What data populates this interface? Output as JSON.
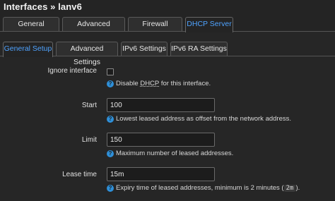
{
  "page": {
    "title": "Interfaces » lanv6"
  },
  "main_tabs": [
    {
      "label": "General Settings"
    },
    {
      "label": "Advanced Settings"
    },
    {
      "label": "Firewall Settings"
    },
    {
      "label": "DHCP Server"
    }
  ],
  "dhcp_tabs": [
    {
      "label": "General Setup"
    },
    {
      "label": "Advanced Settings"
    },
    {
      "label": "IPv6 Settings"
    },
    {
      "label": "IPv6 RA Settings"
    }
  ],
  "form": {
    "ignore_interface": {
      "label": "Ignore interface",
      "checked": false,
      "help_prefix": "Disable ",
      "help_abbr": "DHCP",
      "help_suffix": " for this interface."
    },
    "start": {
      "label": "Start",
      "value": "100",
      "help": "Lowest leased address as offset from the network address."
    },
    "limit": {
      "label": "Limit",
      "value": "150",
      "help": "Maximum number of leased addresses."
    },
    "lease_time": {
      "label": "Lease time",
      "value": "15m",
      "help_prefix": "Expiry time of leased addresses, minimum is 2 minutes (",
      "help_code": "2m",
      "help_suffix": ")."
    }
  },
  "colors": {
    "accent": "#4fa3ff",
    "help_icon": "#2e8fd8",
    "background": "#242424"
  },
  "icons": {
    "help": "question-circle-icon"
  }
}
